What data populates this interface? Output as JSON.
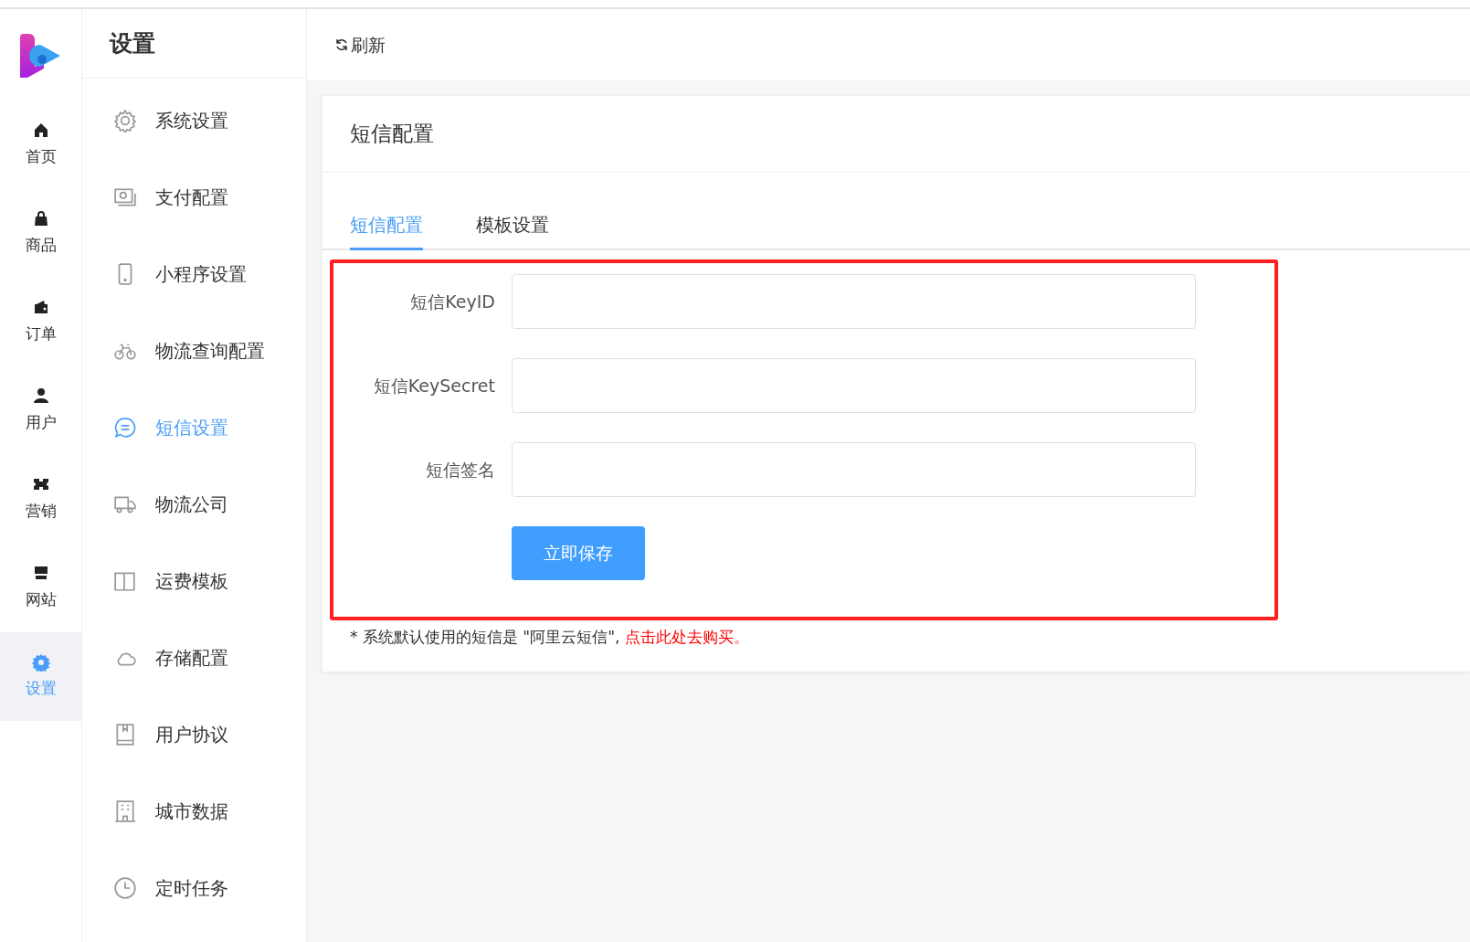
{
  "rail": {
    "items": [
      {
        "label": "首页",
        "selected": false
      },
      {
        "label": "商品",
        "selected": false
      },
      {
        "label": "订单",
        "selected": false
      },
      {
        "label": "用户",
        "selected": false
      },
      {
        "label": "营销",
        "selected": false
      },
      {
        "label": "网站",
        "selected": false
      },
      {
        "label": "设置",
        "selected": true
      }
    ]
  },
  "sidebar": {
    "title": "设置",
    "items": [
      {
        "label": "系统设置",
        "selected": false
      },
      {
        "label": "支付配置",
        "selected": false
      },
      {
        "label": "小程序设置",
        "selected": false
      },
      {
        "label": "物流查询配置",
        "selected": false
      },
      {
        "label": "短信设置",
        "selected": true
      },
      {
        "label": "物流公司",
        "selected": false
      },
      {
        "label": "运费模板",
        "selected": false
      },
      {
        "label": "存储配置",
        "selected": false
      },
      {
        "label": "用户协议",
        "selected": false
      },
      {
        "label": "城市数据",
        "selected": false
      },
      {
        "label": "定时任务",
        "selected": false
      }
    ]
  },
  "toolbar": {
    "refresh": "刷新"
  },
  "card": {
    "title": "短信配置",
    "tabs": [
      {
        "label": "短信配置",
        "selected": true
      },
      {
        "label": "模板设置",
        "selected": false
      }
    ],
    "fields": [
      {
        "label": "短信KeyID"
      },
      {
        "label": "短信KeySecret"
      },
      {
        "label": "短信签名"
      }
    ],
    "save": "立即保存",
    "note": {
      "text": "* 系统默认使用的短信是 \"阿里云短信\", ",
      "link": "点击此处去购买。"
    }
  }
}
